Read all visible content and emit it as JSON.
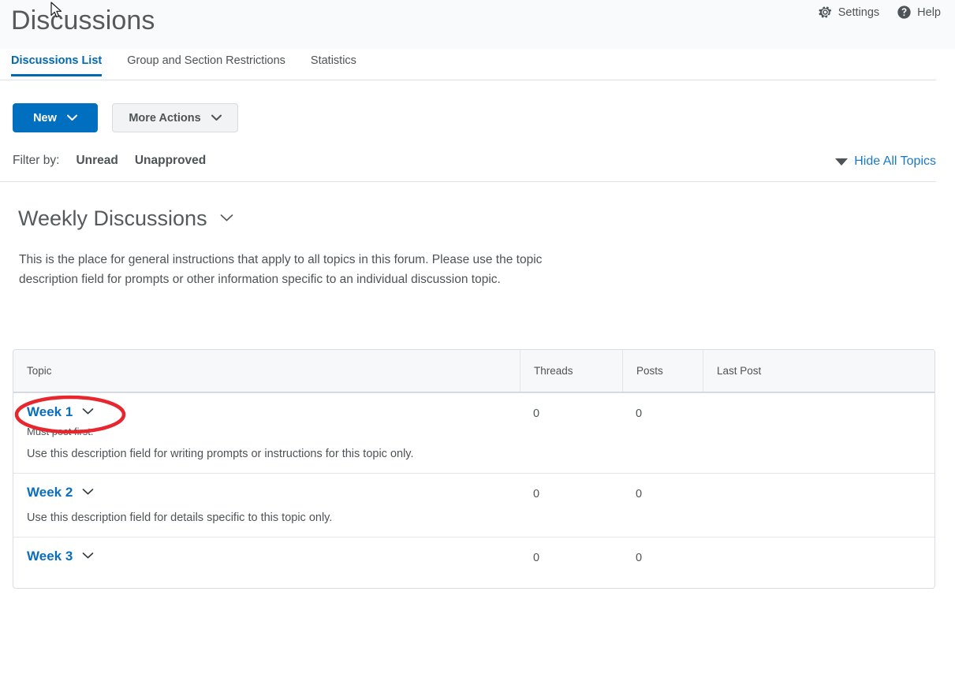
{
  "header": {
    "title": "Discussions",
    "actions": [
      {
        "label": "Settings",
        "icon": "gear-icon"
      },
      {
        "label": "Help",
        "icon": "help-circle-icon"
      }
    ]
  },
  "tabs": [
    {
      "label": "Discussions List",
      "active": true
    },
    {
      "label": "Group and Section Restrictions",
      "active": false
    },
    {
      "label": "Statistics",
      "active": false
    }
  ],
  "toolbar": {
    "new_label": "New",
    "more_actions_label": "More Actions"
  },
  "filter": {
    "label": "Filter by:",
    "options": [
      "Unread",
      "Unapproved"
    ],
    "hide_all_label": "Hide All Topics"
  },
  "forum": {
    "title": "Weekly Discussions",
    "description": "This is the place for general instructions that apply to all topics in this forum.  Please use the topic description field for prompts or other information specific to an individual discussion topic."
  },
  "table": {
    "columns": [
      "Topic",
      "Threads",
      "Posts",
      "Last Post"
    ],
    "rows": [
      {
        "topic": "Week 1",
        "note": "Must post first.",
        "description": "Use this description field for writing prompts or instructions for this topic only.",
        "threads": "0",
        "posts": "0",
        "last_post": ""
      },
      {
        "topic": "Week 2",
        "note": "",
        "description": "Use this description field for details specific to this topic only.",
        "threads": "0",
        "posts": "0",
        "last_post": ""
      },
      {
        "topic": "Week 3",
        "note": "",
        "description": "",
        "threads": "0",
        "posts": "0",
        "last_post": ""
      }
    ]
  },
  "annotation": {
    "shape": "ellipse",
    "color": "#e8262d",
    "target": "Week 1"
  },
  "colors": {
    "primary_blue": "#006fbf",
    "link_blue": "#0a6ebd",
    "tab_active": "#0069b1",
    "text": "#4d5356",
    "annotation_red": "#e8262d"
  }
}
